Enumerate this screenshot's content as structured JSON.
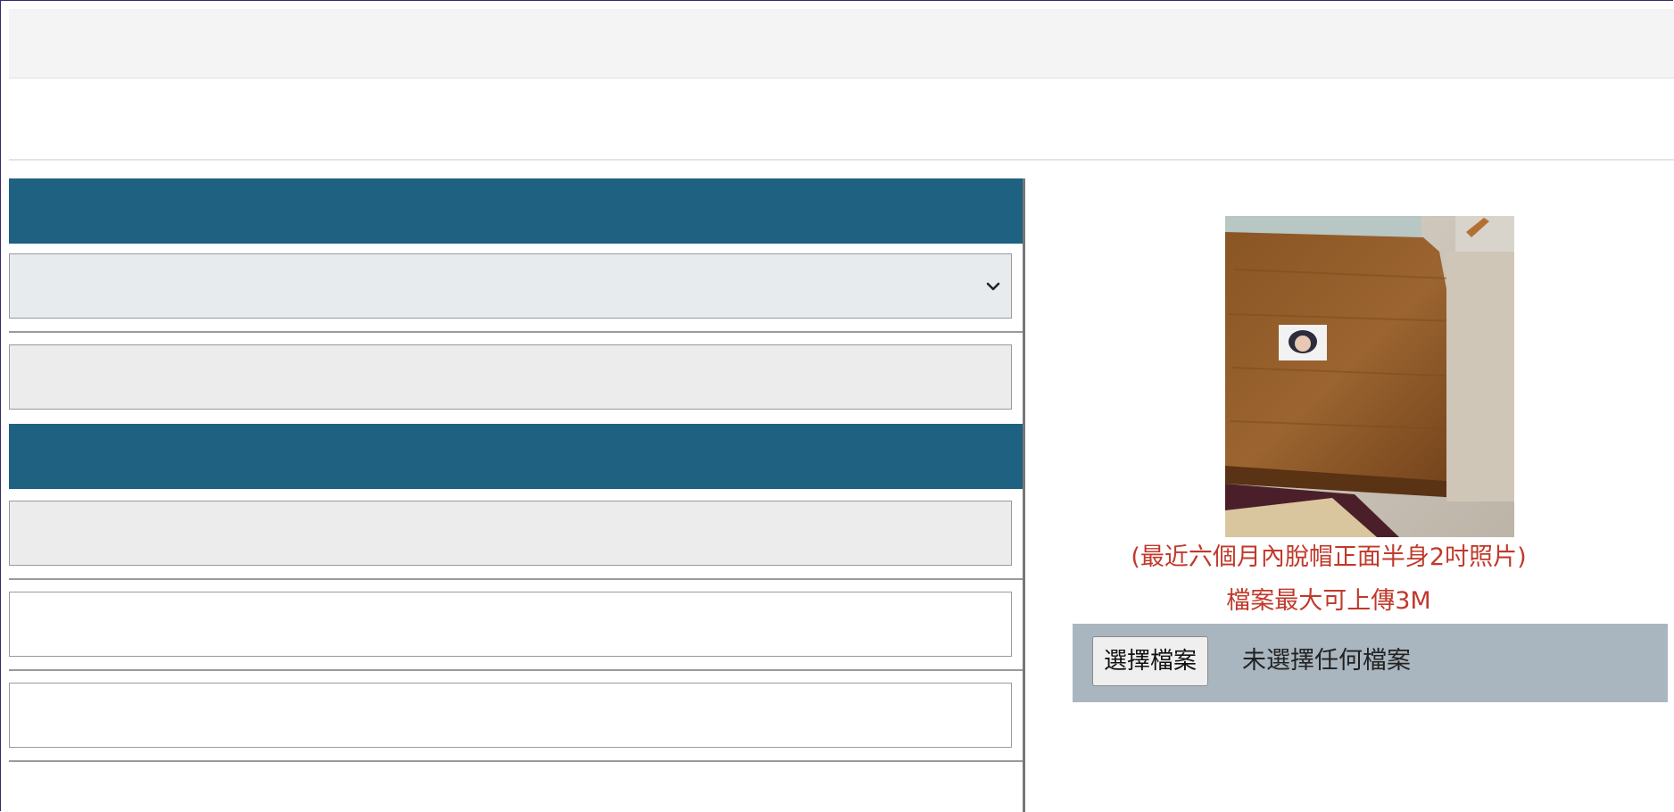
{
  "photo": {
    "caption_line1": "(最近六個月內脫帽正面半身2吋照片)",
    "caption_line2": "檔案最大可上傳3M"
  },
  "upload": {
    "button_label": "選擇檔案",
    "status_text": "未選擇任何檔案"
  },
  "colors": {
    "section_header": "#1f6181",
    "caption_red": "#c0392b",
    "upload_bar": "#aab6bf"
  },
  "icons": {
    "select_chevron": "chevron-down-icon"
  }
}
